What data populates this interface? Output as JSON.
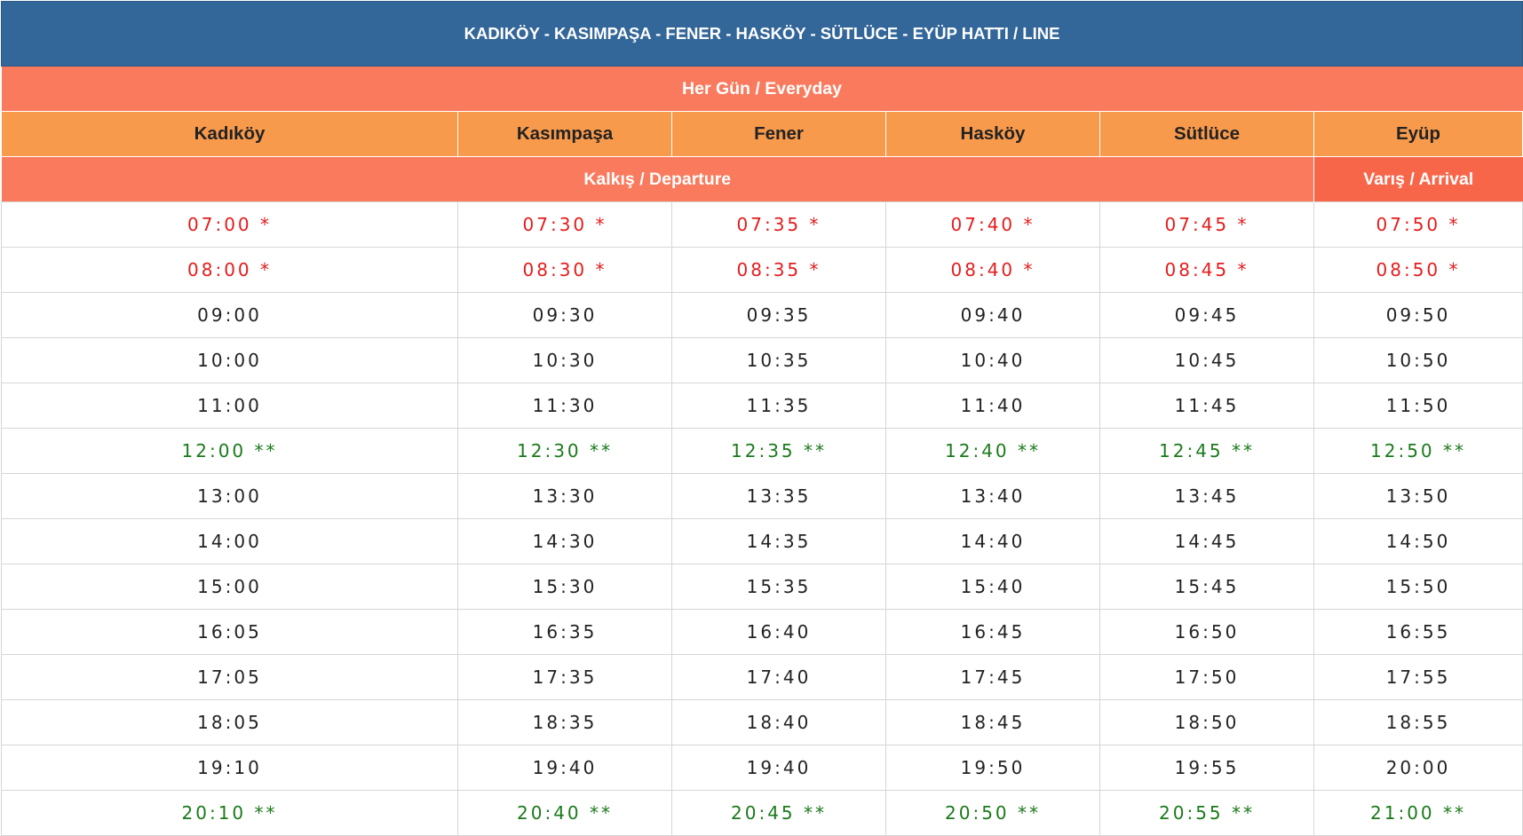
{
  "title": "KADIKÖY - KASIMPAŞA - FENER - HASKÖY - SÜTLÜCE - EYÜP HATTI / LINE",
  "period": "Her Gün / Everyday",
  "stations": [
    "Kadıköy",
    "Kasımpaşa",
    "Fener",
    "Hasköy",
    "Sütlüce",
    "Eyüp"
  ],
  "departure_label": "Kalkış / Departure",
  "arrival_label": "Varış / Arrival",
  "colors": {
    "header": "#336699",
    "banner": "#fa7a5d",
    "station_header": "#f89a4c",
    "arrival_header": "#f8664a",
    "red_trips": "#e51c1c",
    "green_trips": "#1a7a1a"
  },
  "rows": [
    {
      "style": "red",
      "times": [
        "07:00 *",
        "07:30 *",
        "07:35 *",
        "07:40 *",
        "07:45 *",
        "07:50 *"
      ]
    },
    {
      "style": "red",
      "times": [
        "08:00 *",
        "08:30 *",
        "08:35 *",
        "08:40 *",
        "08:45 *",
        "08:50 *"
      ]
    },
    {
      "style": "normal",
      "times": [
        "09:00",
        "09:30",
        "09:35",
        "09:40",
        "09:45",
        "09:50"
      ]
    },
    {
      "style": "normal",
      "times": [
        "10:00",
        "10:30",
        "10:35",
        "10:40",
        "10:45",
        "10:50"
      ]
    },
    {
      "style": "normal",
      "times": [
        "11:00",
        "11:30",
        "11:35",
        "11:40",
        "11:45",
        "11:50"
      ]
    },
    {
      "style": "green",
      "times": [
        "12:00 **",
        "12:30 **",
        "12:35 **",
        "12:40 **",
        "12:45 **",
        "12:50 **"
      ]
    },
    {
      "style": "normal",
      "times": [
        "13:00",
        "13:30",
        "13:35",
        "13:40",
        "13:45",
        "13:50"
      ]
    },
    {
      "style": "normal",
      "times": [
        "14:00",
        "14:30",
        "14:35",
        "14:40",
        "14:45",
        "14:50"
      ]
    },
    {
      "style": "normal",
      "times": [
        "15:00",
        "15:30",
        "15:35",
        "15:40",
        "15:45",
        "15:50"
      ]
    },
    {
      "style": "normal",
      "times": [
        "16:05",
        "16:35",
        "16:40",
        "16:45",
        "16:50",
        "16:55"
      ]
    },
    {
      "style": "normal",
      "times": [
        "17:05",
        "17:35",
        "17:40",
        "17:45",
        "17:50",
        "17:55"
      ]
    },
    {
      "style": "normal",
      "times": [
        "18:05",
        "18:35",
        "18:40",
        "18:45",
        "18:50",
        "18:55"
      ]
    },
    {
      "style": "normal",
      "times": [
        "19:10",
        "19:40",
        "19:40",
        "19:50",
        "19:55",
        "20:00"
      ]
    },
    {
      "style": "green",
      "times": [
        "20:10 **",
        "20:40 **",
        "20:45 **",
        "20:50 **",
        "20:55 **",
        "21:00 **"
      ]
    }
  ]
}
